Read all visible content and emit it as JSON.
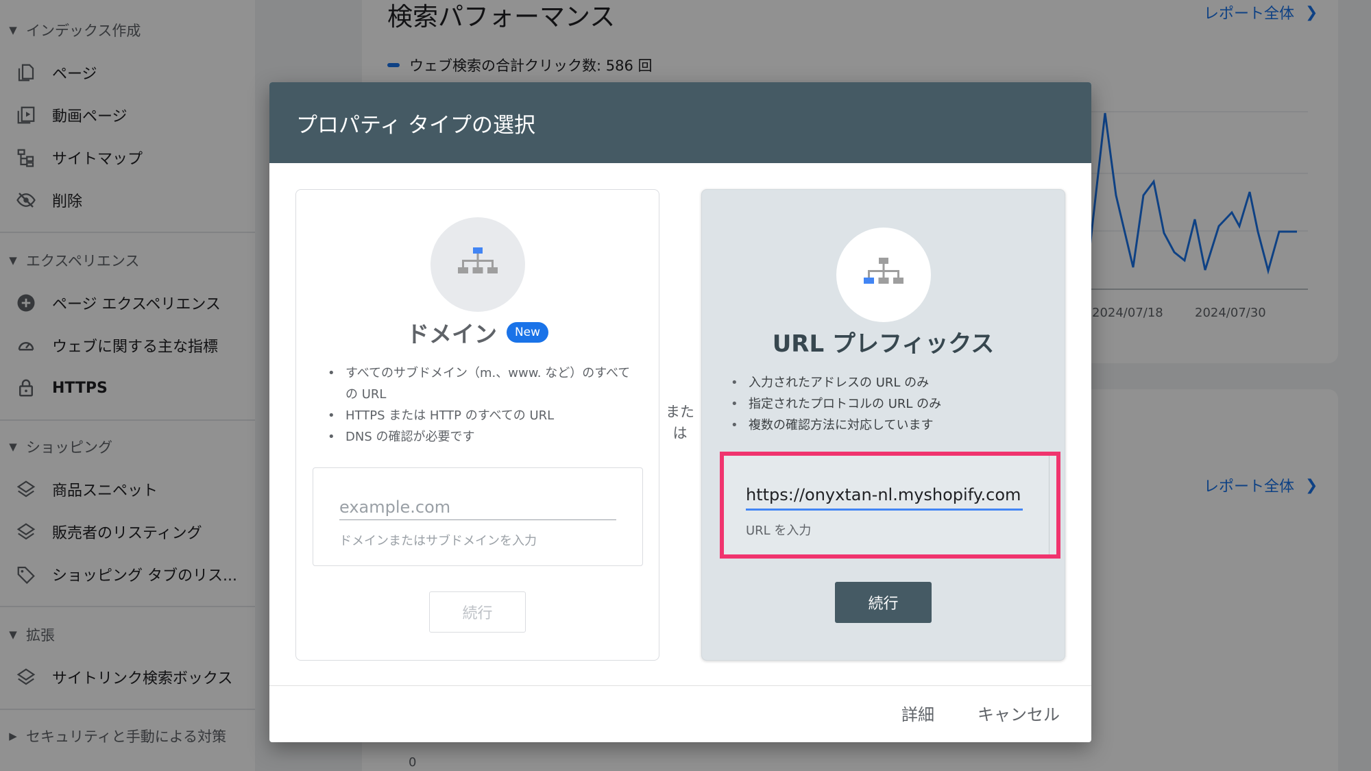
{
  "sidebar": {
    "sections": [
      {
        "label": "インデックス作成",
        "expanded": true
      },
      {
        "label": "エクスペリエンス",
        "expanded": true
      },
      {
        "label": "ショッピング",
        "expanded": true
      },
      {
        "label": "拡張",
        "expanded": true
      },
      {
        "label": "セキュリティと手動による対策",
        "expanded": false
      }
    ],
    "items": [
      {
        "label": "ページ",
        "icon": "page-icon"
      },
      {
        "label": "動画ページ",
        "icon": "video-page-icon"
      },
      {
        "label": "サイトマップ",
        "icon": "sitemap-icon"
      },
      {
        "label": "削除",
        "icon": "visibility-off-icon"
      },
      {
        "label": "ページ エクスペリエンス",
        "icon": "add-circle-icon"
      },
      {
        "label": "ウェブに関する主な指標",
        "icon": "speed-gauge-icon"
      },
      {
        "label": "HTTPS",
        "icon": "lock-icon"
      },
      {
        "label": "商品スニペット",
        "icon": "layers-icon"
      },
      {
        "label": "販売者のリスティング",
        "icon": "layers-icon"
      },
      {
        "label": "ショッピング タブのリス...",
        "icon": "tag-icon"
      },
      {
        "label": "サイトリンク検索ボックス",
        "icon": "layers-icon"
      }
    ]
  },
  "main": {
    "title": "検索パフォーマンス",
    "report_link": "レポート全体",
    "legend": "ウェブ検索の合計クリック数: 586 回",
    "x_ticks": [
      "2024/07/18",
      "2024/07/30"
    ],
    "report_link_2": "レポート全体",
    "y_zero": "0",
    "colors": {
      "series": "#1a73e8",
      "secondary_series": "#188038"
    }
  },
  "dialog": {
    "title": "プロパティ タイプの選択",
    "or_label": "または",
    "domain": {
      "title": "ドメイン",
      "badge": "New",
      "bullets": [
        "すべてのサブドメイン（m.、www. など）のすべての URL",
        "HTTPS または HTTP のすべての URL",
        "DNS の確認が必要です"
      ],
      "input_value": "",
      "input_placeholder": "example.com",
      "input_hint": "ドメインまたはサブドメインを入力",
      "continue_label": "続行",
      "continue_enabled": false
    },
    "prefix": {
      "title": "URL プレフィックス",
      "bullets": [
        "入力されたアドレスの URL のみ",
        "指定されたプロトコルの URL のみ",
        "複数の確認方法に対応しています"
      ],
      "input_value": "https://onyxtan-nl.myshopify.com",
      "input_hint": "URL を入力",
      "continue_label": "続行",
      "continue_enabled": true,
      "highlight_color": "#f0346e"
    },
    "footer": {
      "details_label": "詳細",
      "cancel_label": "キャンセル"
    },
    "colors": {
      "header": "#455a64",
      "badge": "#1a73e8"
    }
  }
}
